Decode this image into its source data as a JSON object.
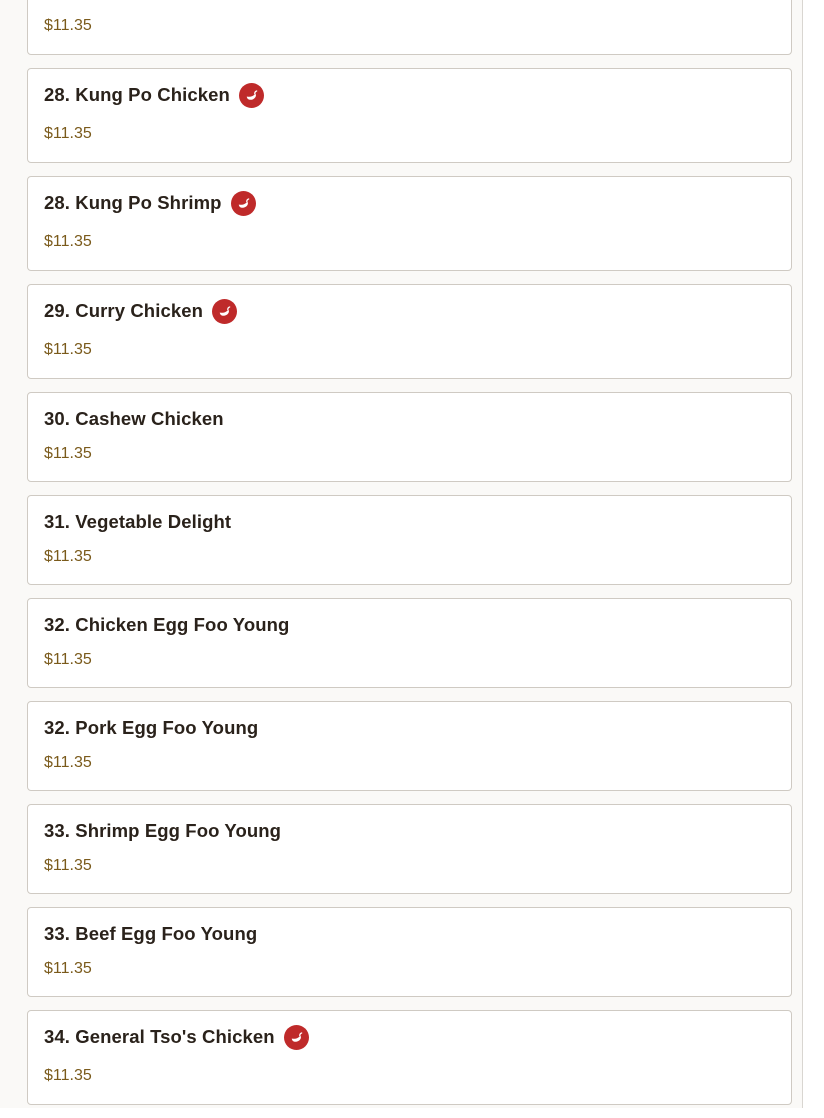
{
  "colors": {
    "price": "#7a5a1b",
    "title": "#2a221b",
    "spicy_badge": "#bf2a2a",
    "card_border": "#cfcac3",
    "background": "#faf9f7"
  },
  "spicy_icon_name": "chili-pepper-icon",
  "menu": {
    "items": [
      {
        "name": "",
        "price": "$11.35",
        "spicy": true
      },
      {
        "name": "28. Kung Po Chicken",
        "price": "$11.35",
        "spicy": true
      },
      {
        "name": "28. Kung Po Shrimp",
        "price": "$11.35",
        "spicy": true
      },
      {
        "name": "29. Curry Chicken",
        "price": "$11.35",
        "spicy": true
      },
      {
        "name": "30. Cashew Chicken",
        "price": "$11.35",
        "spicy": false
      },
      {
        "name": "31. Vegetable Delight",
        "price": "$11.35",
        "spicy": false
      },
      {
        "name": "32. Chicken Egg Foo Young",
        "price": "$11.35",
        "spicy": false
      },
      {
        "name": "32. Pork Egg Foo Young",
        "price": "$11.35",
        "spicy": false
      },
      {
        "name": "33. Shrimp Egg Foo Young",
        "price": "$11.35",
        "spicy": false
      },
      {
        "name": "33. Beef Egg Foo Young",
        "price": "$11.35",
        "spicy": false
      },
      {
        "name": "34. General Tso's Chicken",
        "price": "$11.35",
        "spicy": true
      }
    ]
  }
}
